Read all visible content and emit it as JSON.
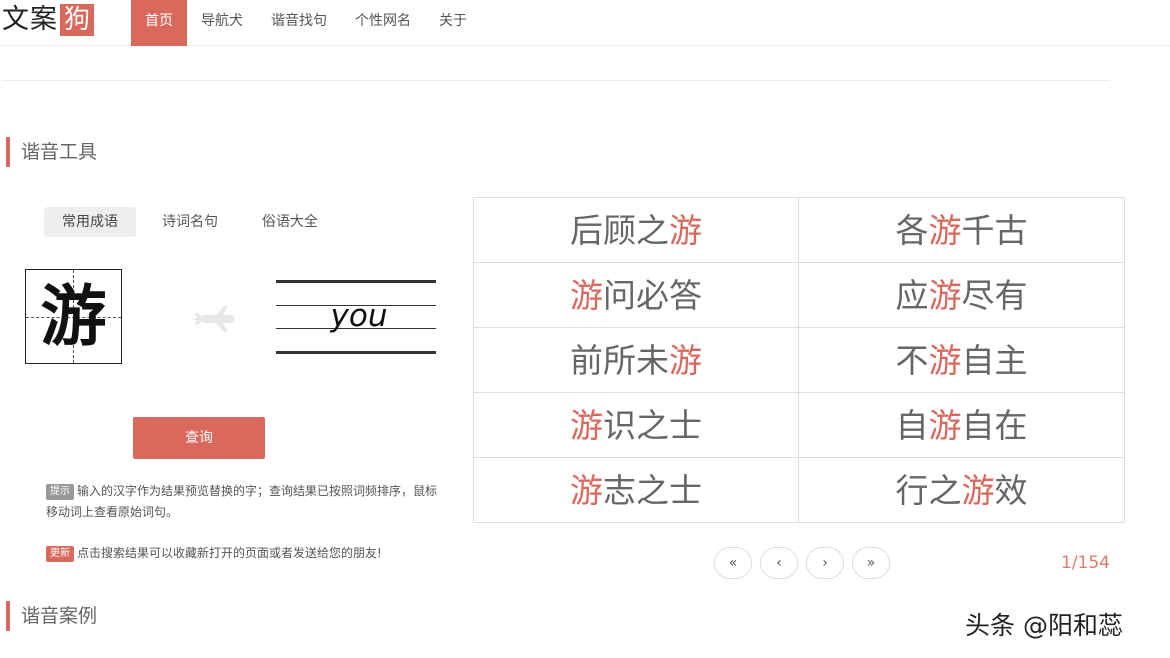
{
  "logo": {
    "text": "文案",
    "box": "狗"
  },
  "nav": {
    "items": [
      {
        "label": "首页",
        "active": true
      },
      {
        "label": "导航犬",
        "active": false
      },
      {
        "label": "谐音找句",
        "active": false
      },
      {
        "label": "个性网名",
        "active": false
      },
      {
        "label": "关于",
        "active": false
      }
    ]
  },
  "sections": {
    "tool_title": "谐音工具",
    "cases_title": "谐音案例"
  },
  "tabs": [
    {
      "label": "常用成语",
      "active": true
    },
    {
      "label": "诗词名句",
      "active": false
    },
    {
      "label": "俗语大全",
      "active": false
    }
  ],
  "input": {
    "character": "游",
    "pinyin": "you"
  },
  "icons": {
    "arrow": "airplane-icon"
  },
  "query_button": "查询",
  "hints": {
    "tip_badge": "提示",
    "tip_text": "输入的汉字作为结果预览替换的字；查询结果已按照词频排序，鼠标移动词上查看原始词句。",
    "update_badge": "更新",
    "update_text": "点击搜索结果可以收藏新打开的页面或者发送给您的朋友!"
  },
  "results": [
    {
      "pre": "后顾之",
      "hi": "游",
      "post": ""
    },
    {
      "pre": "各",
      "hi": "游",
      "post": "千古"
    },
    {
      "pre": "",
      "hi": "游",
      "post": "问必答"
    },
    {
      "pre": "应",
      "hi": "游",
      "post": "尽有"
    },
    {
      "pre": "前所未",
      "hi": "游",
      "post": ""
    },
    {
      "pre": "不",
      "hi": "游",
      "post": "自主"
    },
    {
      "pre": "",
      "hi": "游",
      "post": "识之士"
    },
    {
      "pre": "自",
      "hi": "游",
      "post": "自在"
    },
    {
      "pre": "",
      "hi": "游",
      "post": "志之士"
    },
    {
      "pre": "行之",
      "hi": "游",
      "post": "效"
    }
  ],
  "pager": {
    "first": "«",
    "prev": "‹",
    "next": "›",
    "last": "»",
    "page_count": "1/154"
  },
  "watermark": "头条 @阳和蕊",
  "colors": {
    "accent": "#d9695d"
  }
}
